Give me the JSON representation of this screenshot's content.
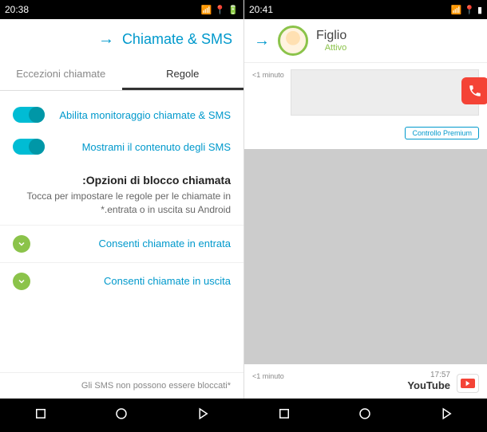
{
  "status": {
    "time_left": "20:41",
    "time_right": "20:38"
  },
  "left": {
    "profile": {
      "name": "Figlio",
      "status": "Attivo"
    },
    "activity1": {
      "time": "<1 minuto"
    },
    "premium": "Controllo Premium",
    "bottom": {
      "time": "<1 minuto",
      "entry_time": "17:57",
      "entry_title": "YouTube"
    }
  },
  "right": {
    "title": "Chiamate & SMS",
    "tabs": {
      "rules": "Regole",
      "exceptions": "Eccezioni chiamate"
    },
    "settings": {
      "monitor": "Abilita monitoraggio chiamate & SMS",
      "show_content": "Mostrami il contenuto degli SMS"
    },
    "block": {
      "title": "Opzioni di blocco chiamata:",
      "desc": "Tocca per impostare le regole per le chiamate in entrata o in uscita su Android.*",
      "incoming": "Consenti chiamate in entrata",
      "outgoing": "Consenti chiamate in uscita"
    },
    "footer": "*Gli SMS non possono essere bloccati"
  }
}
